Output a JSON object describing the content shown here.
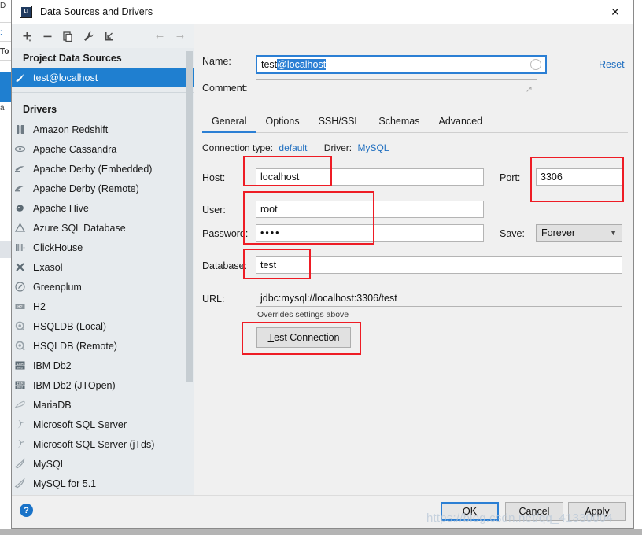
{
  "window": {
    "title": "Data Sources and Drivers",
    "app_logo": "intellij-logo",
    "close_label": "✕"
  },
  "toolbar": {
    "buttons": [
      {
        "name": "add",
        "glyph": "+"
      },
      {
        "name": "remove",
        "glyph": "−"
      },
      {
        "name": "duplicate",
        "glyph": "copy-icon"
      },
      {
        "name": "properties",
        "glyph": "wrench-icon"
      },
      {
        "name": "import",
        "glyph": "import-icon"
      }
    ],
    "nav": [
      {
        "name": "back",
        "glyph": "←"
      },
      {
        "name": "forward",
        "glyph": "→"
      }
    ]
  },
  "sidebar": {
    "project_section": "Project Data Sources",
    "data_sources": [
      {
        "label": "test@localhost",
        "icon": "mysql-icon",
        "selected": true
      }
    ],
    "drivers_section": "Drivers",
    "drivers": [
      {
        "label": "Amazon Redshift",
        "icon": "redshift-icon"
      },
      {
        "label": "Apache Cassandra",
        "icon": "cassandra-icon"
      },
      {
        "label": "Apache Derby (Embedded)",
        "icon": "derby-icon"
      },
      {
        "label": "Apache Derby (Remote)",
        "icon": "derby-icon"
      },
      {
        "label": "Apache Hive",
        "icon": "hive-icon"
      },
      {
        "label": "Azure SQL Database",
        "icon": "azure-icon"
      },
      {
        "label": "ClickHouse",
        "icon": "clickhouse-icon"
      },
      {
        "label": "Exasol",
        "icon": "exasol-icon"
      },
      {
        "label": "Greenplum",
        "icon": "greenplum-icon"
      },
      {
        "label": "H2",
        "icon": "h2-icon"
      },
      {
        "label": "HSQLDB (Local)",
        "icon": "hsqldb-icon"
      },
      {
        "label": "HSQLDB (Remote)",
        "icon": "hsqldb-icon"
      },
      {
        "label": "IBM Db2",
        "icon": "db2-icon"
      },
      {
        "label": "IBM Db2 (JTOpen)",
        "icon": "db2-icon"
      },
      {
        "label": "MariaDB",
        "icon": "mariadb-icon"
      },
      {
        "label": "Microsoft SQL Server",
        "icon": "mssql-icon"
      },
      {
        "label": "Microsoft SQL Server (jTds)",
        "icon": "mssql-icon"
      },
      {
        "label": "MySQL",
        "icon": "mysql-icon"
      },
      {
        "label": "MySQL for 5.1",
        "icon": "mysql-icon"
      }
    ]
  },
  "form": {
    "name_label": "Name:",
    "name_value_plain": "test",
    "name_value_selected": "@localhost",
    "reset_label": "Reset",
    "comment_label": "Comment:",
    "comment_value": "",
    "tabs": [
      {
        "label": "General",
        "active": true
      },
      {
        "label": "Options",
        "active": false
      },
      {
        "label": "SSH/SSL",
        "active": false
      },
      {
        "label": "Schemas",
        "active": false
      },
      {
        "label": "Advanced",
        "active": false
      }
    ],
    "connection_type_label": "Connection type:",
    "connection_type_value": "default",
    "driver_label": "Driver:",
    "driver_value": "MySQL",
    "host_label": "Host:",
    "host_value": "localhost",
    "port_label": "Port:",
    "port_value": "3306",
    "user_label": "User:",
    "user_value": "root",
    "password_label": "Password:",
    "password_value": "••••",
    "save_label": "Save:",
    "save_value": "Forever",
    "database_label": "Database:",
    "database_value": "test",
    "url_label": "URL:",
    "url_value": "jdbc:mysql://localhost:3306/test",
    "url_hint": "Overrides settings above",
    "test_connection_mnemonic": "T",
    "test_connection_rest": "est Connection"
  },
  "footer": {
    "help_glyph": "?",
    "ok_label": "OK",
    "cancel_label": "Cancel",
    "apply_label": "Apply"
  },
  "watermark": "https://blog.csdn.net/qq_41330004",
  "colors": {
    "accent_blue": "#2b7fd4",
    "selection_blue": "#1f7fd0",
    "link_blue": "#2270c0",
    "annotation_red": "#ee1c25",
    "panel_bg": "#f0f0f0",
    "sidebar_bg": "#e7ebee"
  },
  "background_peek": {
    "left_texts": [
      "D",
      "To",
      "a"
    ]
  }
}
